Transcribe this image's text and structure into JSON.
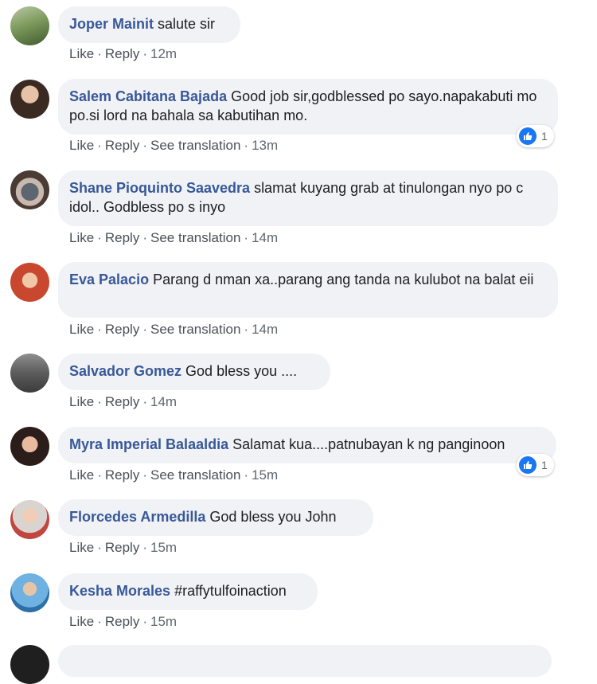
{
  "colors": {
    "author": "#385898",
    "bubble": "#f0f2f5",
    "meta": "#606770",
    "like_blue": "#1877f2"
  },
  "action_labels": {
    "like": "Like",
    "reply": "Reply",
    "see_translation": "See translation"
  },
  "comments": [
    {
      "author": "Joper Mainit",
      "text": "salute sir",
      "time": "12m",
      "translation": false,
      "reactions": null
    },
    {
      "author": "Salem Cabitana Bajada",
      "text": "Good job sir,godblessed po sayo.napakabuti mo po.si lord na bahala sa kabutihan mo.",
      "time": "13m",
      "translation": true,
      "reactions": "1"
    },
    {
      "author": "Shane Pioquinto Saavedra",
      "text": "slamat kuyang grab at tinulongan nyo po c idol.. Godbless po s inyo",
      "time": "14m",
      "translation": true,
      "reactions": null
    },
    {
      "author": "Eva Palacio",
      "text": "Parang d nman xa..parang ang tanda na kulubot na balat eii",
      "time": "14m",
      "translation": true,
      "reactions": null
    },
    {
      "author": "Salvador Gomez",
      "text": "God bless you ....",
      "time": "14m",
      "translation": false,
      "reactions": null
    },
    {
      "author": "Myra Imperial Balaaldia",
      "text": "Salamat kua....patnubayan k ng panginoon",
      "time": "15m",
      "translation": true,
      "reactions": "1"
    },
    {
      "author": "Florcedes Armedilla",
      "text": "God bless you John",
      "time": "15m",
      "translation": false,
      "reactions": null
    },
    {
      "author": "Kesha Morales",
      "text": "#raffytulfoinaction",
      "time": "15m",
      "translation": false,
      "reactions": null
    }
  ]
}
